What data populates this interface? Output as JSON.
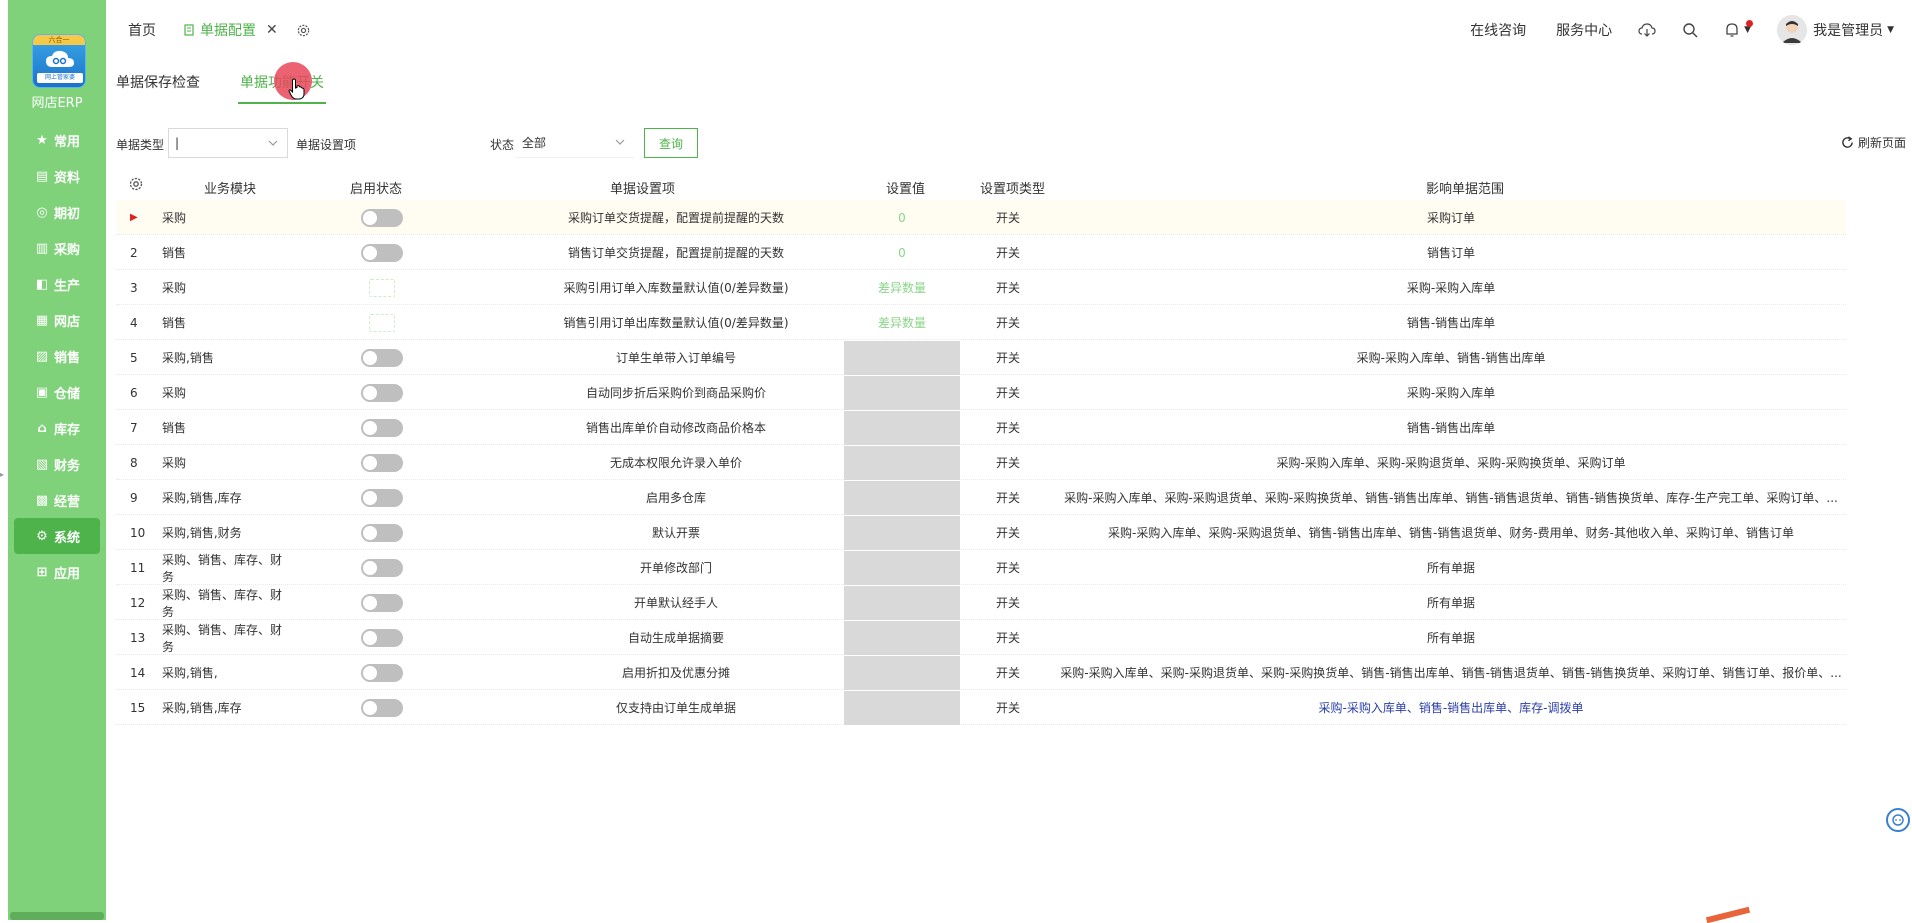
{
  "sidebar": {
    "logo_top": "六合一",
    "logo_sub": "网上管家婆",
    "brand": "网店ERP",
    "items": [
      {
        "label": "常用",
        "icon": "star-icon"
      },
      {
        "label": "资料",
        "icon": "folder-icon"
      },
      {
        "label": "期初",
        "icon": "target-icon"
      },
      {
        "label": "采购",
        "icon": "cart-icon"
      },
      {
        "label": "生产",
        "icon": "factory-icon"
      },
      {
        "label": "网店",
        "icon": "store-icon"
      },
      {
        "label": "销售",
        "icon": "chart-icon"
      },
      {
        "label": "仓储",
        "icon": "warehouse-icon"
      },
      {
        "label": "库存",
        "icon": "house-icon"
      },
      {
        "label": "财务",
        "icon": "wallet-icon"
      },
      {
        "label": "经营",
        "icon": "shop-icon"
      },
      {
        "label": "系统",
        "icon": "gear-icon"
      },
      {
        "label": "应用",
        "icon": "plus-box-icon"
      }
    ],
    "active": "系统"
  },
  "topbar": {
    "home_tab": "首页",
    "active_tab": "单据配置",
    "close_glyph": "✕",
    "online_consult": "在线咨询",
    "service_center": "服务中心",
    "user_name": "我是管理员"
  },
  "subtabs": [
    {
      "label": "单据保存检查"
    },
    {
      "label": "单据功能开关"
    }
  ],
  "filters": {
    "doc_type_label": "单据类型",
    "doc_type_value": "|",
    "setting_item_label": "单据设置项",
    "status_label": "状态",
    "status_value": "全部",
    "query_button": "查询",
    "refresh_label": "刷新页面"
  },
  "table": {
    "headers": {
      "module": "业务模块",
      "enabled": "启用状态",
      "item": "单据设置项",
      "value": "设置值",
      "type": "设置项类型",
      "scope": "影响单据范围"
    },
    "rows": [
      {
        "no": "",
        "module": "采购",
        "item": "采购订单交货提醒，配置提前提醒的天数",
        "value": "0",
        "value_kind": "text",
        "type": "开关",
        "scope": "采购订单",
        "toggle": "switch"
      },
      {
        "no": "2",
        "module": "销售",
        "item": "销售订单交货提醒，配置提前提醒的天数",
        "value": "0",
        "value_kind": "text",
        "type": "开关",
        "scope": "销售订单",
        "toggle": "switch"
      },
      {
        "no": "3",
        "module": "采购",
        "item": "采购引用订单入库数量默认值(0/差异数量)",
        "value": "差异数量",
        "value_kind": "text",
        "type": "开关",
        "scope": "采购-采购入库单",
        "toggle": "faint"
      },
      {
        "no": "4",
        "module": "销售",
        "item": "销售引用订单出库数量默认值(0/差异数量)",
        "value": "差异数量",
        "value_kind": "text",
        "type": "开关",
        "scope": "销售-销售出库单",
        "toggle": "faint"
      },
      {
        "no": "5",
        "module": "采购,销售",
        "item": "订单生单带入订单编号",
        "value": "",
        "value_kind": "gray",
        "type": "开关",
        "scope": "采购-采购入库单、销售-销售出库单",
        "toggle": "switch"
      },
      {
        "no": "6",
        "module": "采购",
        "item": "自动同步折后采购价到商品采购价",
        "value": "",
        "value_kind": "gray",
        "type": "开关",
        "scope": "采购-采购入库单",
        "toggle": "switch"
      },
      {
        "no": "7",
        "module": "销售",
        "item": "销售出库单价自动修改商品价格本",
        "value": "",
        "value_kind": "gray",
        "type": "开关",
        "scope": "销售-销售出库单",
        "toggle": "switch"
      },
      {
        "no": "8",
        "module": "采购",
        "item": "无成本权限允许录入单价",
        "value": "",
        "value_kind": "gray",
        "type": "开关",
        "scope": "采购-采购入库单、采购-采购退货单、采购-采购换货单、采购订单",
        "toggle": "switch"
      },
      {
        "no": "9",
        "module": "采购,销售,库存",
        "item": "启用多仓库",
        "value": "",
        "value_kind": "gray",
        "type": "开关",
        "scope": "采购-采购入库单、采购-采购退货单、采购-采购换货单、销售-销售出库单、销售-销售退货单、销售-销售换货单、库存-生产完工单、采购订单、...",
        "toggle": "switch"
      },
      {
        "no": "10",
        "module": "采购,销售,财务",
        "item": "默认开票",
        "value": "",
        "value_kind": "gray",
        "type": "开关",
        "scope": "采购-采购入库单、采购-采购退货单、销售-销售出库单、销售-销售退货单、财务-费用单、财务-其他收入单、采购订单、销售订单",
        "toggle": "switch"
      },
      {
        "no": "11",
        "module": "采购、销售、库存、财务",
        "item": "开单修改部门",
        "value": "",
        "value_kind": "gray",
        "type": "开关",
        "scope": "所有单据",
        "toggle": "switch"
      },
      {
        "no": "12",
        "module": "采购、销售、库存、财务",
        "item": "开单默认经手人",
        "value": "",
        "value_kind": "gray",
        "type": "开关",
        "scope": "所有单据",
        "toggle": "switch"
      },
      {
        "no": "13",
        "module": "采购、销售、库存、财务",
        "item": "自动生成单据摘要",
        "value": "",
        "value_kind": "gray",
        "type": "开关",
        "scope": "所有单据",
        "toggle": "switch"
      },
      {
        "no": "14",
        "module": "采购,销售,",
        "item": "启用折扣及优惠分摊",
        "value": "",
        "value_kind": "gray",
        "type": "开关",
        "scope": "采购-采购入库单、采购-采购退货单、采购-采购换货单、销售-销售出库单、销售-销售退货单、销售-销售换货单、采购订单、销售订单、报价单、...",
        "toggle": "switch"
      },
      {
        "no": "15",
        "module": "采购,销售,库存",
        "item": "仅支持由订单生成单据",
        "value": "",
        "value_kind": "gray",
        "type": "开关",
        "scope": "采购-采购入库单、销售-销售出库单、库存-调拨单",
        "toggle": "switch",
        "scope_color": "blue"
      }
    ]
  },
  "colors": {
    "brand_green": "#4db34a",
    "sidebar_green": "#7fd27a",
    "active_blue_text": "#2b3fa8",
    "selected_marker": "#e02020"
  }
}
